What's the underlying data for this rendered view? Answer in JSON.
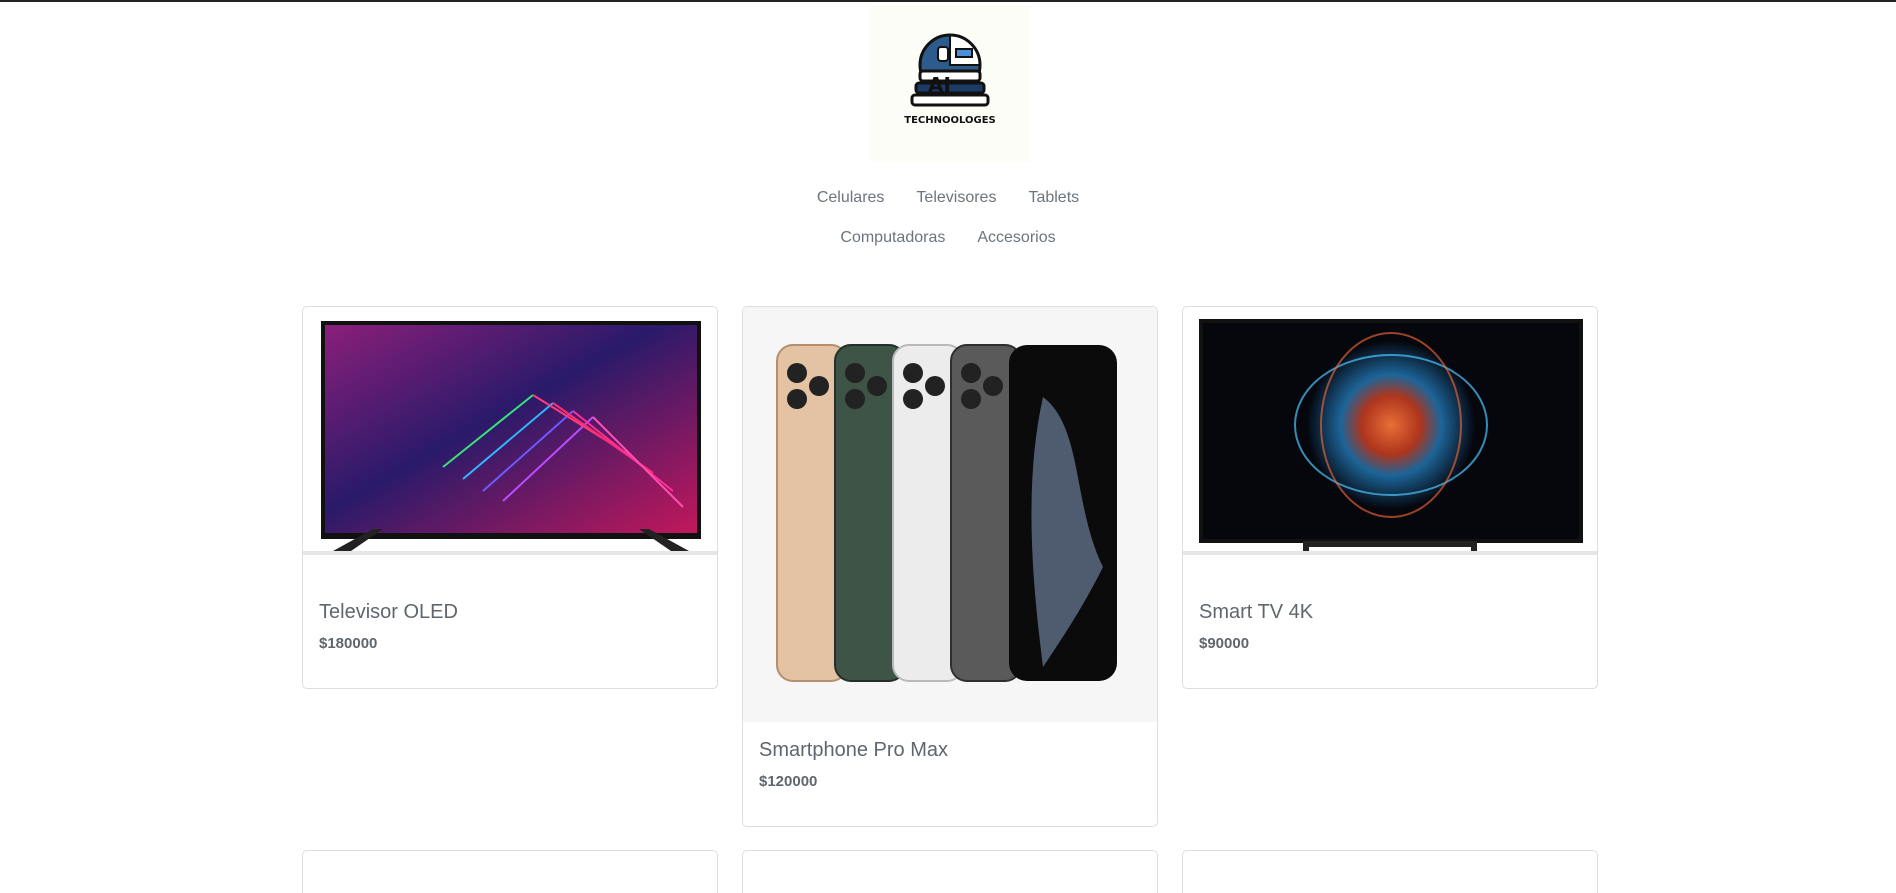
{
  "brand": {
    "logo_text": "TECHNOOLOGES",
    "logo_mark": "AI"
  },
  "nav": {
    "row1": [
      "Celulares",
      "Televisores",
      "Tablets"
    ],
    "row2": [
      "Computadoras",
      "Accesorios"
    ]
  },
  "products": [
    {
      "title": "Televisor OLED",
      "price": "$180000",
      "image": "tv-neon-lines-image"
    },
    {
      "title": "Smartphone Pro Max",
      "price": "$120000",
      "image": "smartphones-image"
    },
    {
      "title": "Smart TV 4K",
      "price": "$90000",
      "image": "tv-orb-image"
    }
  ],
  "colors": {
    "nav_text": "#6c757d",
    "card_border": "#dcdfe2",
    "title_text": "#5f666d"
  }
}
